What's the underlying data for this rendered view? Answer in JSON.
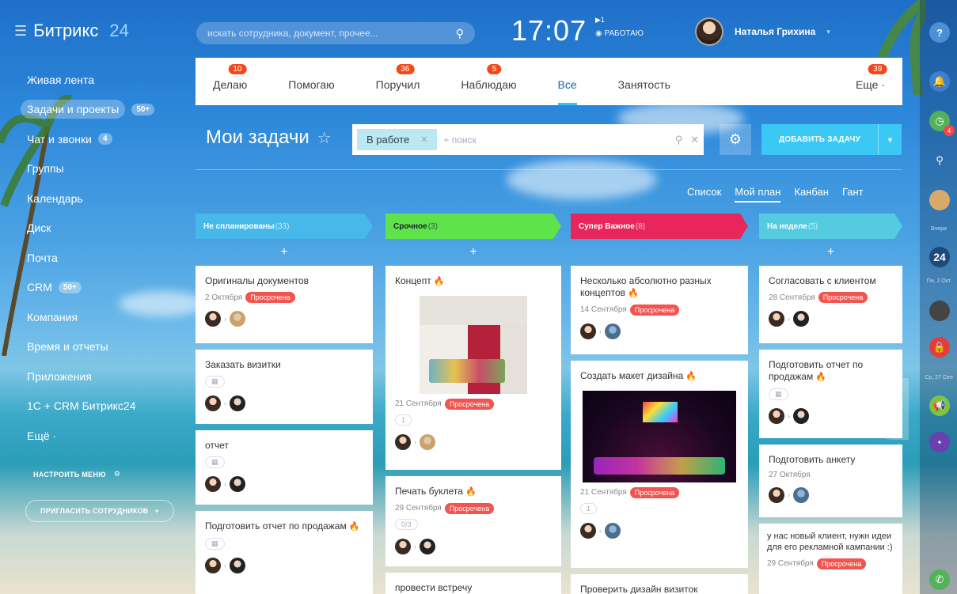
{
  "app": {
    "name": "Битрикс",
    "name_suffix": "24"
  },
  "header": {
    "search_placeholder": "искать сотрудника, документ, прочее...",
    "time": "17:07",
    "workday_flag": "▶1",
    "workday_status": "◉ РАБОТАЮ",
    "user_name": "Наталья Грихина"
  },
  "left_menu": {
    "items": [
      {
        "label": "Живая лента",
        "badge": ""
      },
      {
        "label": "Задачи и проекты",
        "badge": "50+"
      },
      {
        "label": "Чат и звонки",
        "badge": "4"
      },
      {
        "label": "Группы",
        "badge": ""
      },
      {
        "label": "Календарь",
        "badge": ""
      },
      {
        "label": "Диск",
        "badge": ""
      },
      {
        "label": "Почта",
        "badge": ""
      },
      {
        "label": "CRM",
        "badge": "50+"
      },
      {
        "label": "Компания",
        "badge": ""
      },
      {
        "label": "Время и отчеты",
        "badge": ""
      },
      {
        "label": "Приложения",
        "badge": ""
      },
      {
        "label": "1С + CRM Битрикс24",
        "badge": ""
      },
      {
        "label": "Ещё ·",
        "badge": ""
      }
    ],
    "setup_label": "НАСТРОИТЬ МЕНЮ",
    "invite_label": "ПРИГЛАСИТЬ СОТРУДНИКОВ"
  },
  "tabs": [
    {
      "label": "Делаю",
      "count": "10"
    },
    {
      "label": "Помогаю",
      "count": ""
    },
    {
      "label": "Поручил",
      "count": "36"
    },
    {
      "label": "Наблюдаю",
      "count": "5"
    },
    {
      "label": "Все",
      "count": ""
    },
    {
      "label": "Занятость",
      "count": ""
    },
    {
      "label": "Еще ·",
      "count": "39"
    }
  ],
  "page": {
    "title": "Мои задачи",
    "filter_chip": "В работе",
    "filter_placeholder": "+ поиск",
    "add_task_label": "ДОБАВИТЬ ЗАДАЧУ",
    "view_tabs": [
      "Список",
      "Мой план",
      "Канбан",
      "Гант"
    ]
  },
  "right_bar": {
    "label_yesterday": "Вчера",
    "label_date1": "Пн, 2 Окт",
    "label_date2": "Ср, 27 Сен",
    "app_badge": "24",
    "notif_count": "4"
  },
  "columns": [
    {
      "name": "Не спланированы",
      "count": "(33)",
      "color": "#47b8ea",
      "cards": [
        {
          "title": "Оригиналы документов",
          "fire": false,
          "date": "2 Октября",
          "overdue": "Просрочена",
          "checklist": "",
          "cal": false
        },
        {
          "title": "Заказать визитки",
          "fire": false,
          "date": "",
          "overdue": "",
          "checklist": "",
          "cal": true
        },
        {
          "title": "отчет",
          "fire": false,
          "date": "",
          "overdue": "",
          "checklist": "",
          "cal": true
        },
        {
          "title": "Подготовить отчет по продажам",
          "fire": true,
          "date": "",
          "overdue": "",
          "checklist": "",
          "cal": true
        }
      ]
    },
    {
      "name": "Срочное",
      "count": "(3)",
      "color": "#5ee34a",
      "cards": [
        {
          "title": "Концепт",
          "fire": true,
          "date": "21 Сентября",
          "overdue": "Просрочена",
          "checklist": "1",
          "cal": false
        },
        {
          "title": "Печать буклета",
          "fire": true,
          "date": "29 Сентября",
          "overdue": "Просрочена",
          "checklist": "0/3",
          "cal": false
        },
        {
          "title": "провести встречу",
          "fire": false,
          "date": "",
          "overdue": "",
          "checklist": "",
          "cal": false
        }
      ]
    },
    {
      "name": "Супер Важное",
      "count": "(8)",
      "color": "#e8265c",
      "cards": [
        {
          "title": "Несколько абсолютно разных концептов",
          "fire": true,
          "date": "14 Сентября",
          "overdue": "Просрочена",
          "checklist": "",
          "cal": false
        },
        {
          "title": "Создать макет дизайна",
          "fire": true,
          "date": "21 Сентября",
          "overdue": "Просрочена",
          "checklist": "1",
          "cal": false
        },
        {
          "title": "Проверить дизайн визиток",
          "fire": false,
          "date": "",
          "overdue": "",
          "checklist": "",
          "cal": false
        }
      ]
    },
    {
      "name": "На неделе",
      "count": "(5)",
      "color": "#55cbe0",
      "cards": [
        {
          "title": "Согласовать с клиентом",
          "fire": false,
          "date": "28 Сентября",
          "overdue": "Просрочена",
          "checklist": "",
          "cal": false
        },
        {
          "title": "Подготовить отчет по продажам",
          "fire": true,
          "date": "",
          "overdue": "",
          "checklist": "",
          "cal": true
        },
        {
          "title": "Подготовить анкету",
          "fire": false,
          "date": "27 Октября",
          "overdue": "",
          "checklist": "",
          "cal": false
        },
        {
          "title": "у нас новый клиент, нужн идеи для его рекламной кампании :)",
          "fire": false,
          "date": "29 Сентября",
          "overdue": "Просрочена",
          "checklist": "",
          "cal": false
        }
      ]
    }
  ]
}
